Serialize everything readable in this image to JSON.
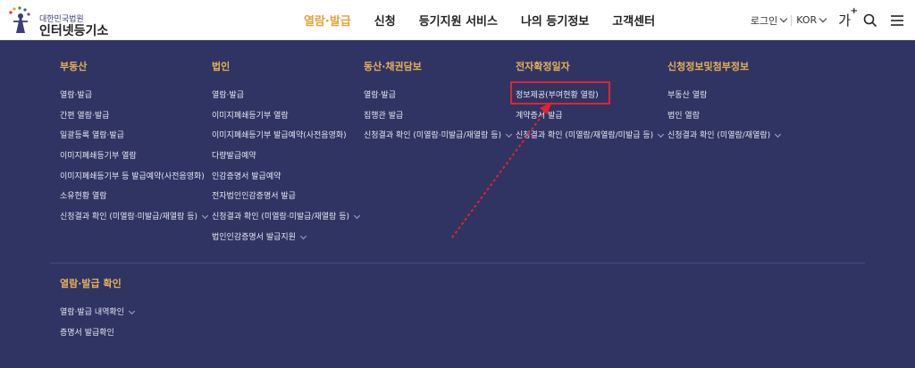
{
  "header": {
    "logo_small": "대한민국법원",
    "logo_big": "인터넷등기소",
    "gnb": [
      {
        "label": "열람·발급",
        "active": true
      },
      {
        "label": "신청",
        "active": false
      },
      {
        "label": "등기지원 서비스",
        "active": false
      },
      {
        "label": "나의 등기정보",
        "active": false
      },
      {
        "label": "고객센터",
        "active": false
      }
    ],
    "util": {
      "login": "로그인",
      "lang": "KOR",
      "font_size": "가",
      "font_plus": "+",
      "search_icon": "search-icon",
      "menu_icon": "hamburger-icon"
    }
  },
  "mega_menu": {
    "columns": [
      {
        "title": "부동산",
        "items": [
          {
            "label": "열람·발급",
            "has_sub": false
          },
          {
            "label": "간편 열람·발급",
            "has_sub": false
          },
          {
            "label": "일괄등록 열람·발급",
            "has_sub": false
          },
          {
            "label": "이미지폐쇄등기부 열람",
            "has_sub": false
          },
          {
            "label": "이미지폐쇄등기부 등 발급예약(사전음영화)",
            "has_sub": false
          },
          {
            "label": "소유현황 열람",
            "has_sub": false
          },
          {
            "label": "신청결과 확인 (미열람·미발급/재열람 등)",
            "has_sub": true
          }
        ]
      },
      {
        "title": "법인",
        "items": [
          {
            "label": "열람·발급",
            "has_sub": false
          },
          {
            "label": "이미지폐쇄등기부 열람",
            "has_sub": false
          },
          {
            "label": "이미지폐쇄등기부 발급예약(사전음영화)",
            "has_sub": false
          },
          {
            "label": "다량발급예약",
            "has_sub": false
          },
          {
            "label": "인감증명서 발급예약",
            "has_sub": false
          },
          {
            "label": "전자법인인감증명서 발급",
            "has_sub": false
          },
          {
            "label": "신청결과 확인 (미열람·미발급/재열람 등)",
            "has_sub": true
          },
          {
            "label": "법인인감증명서 발급지원",
            "has_sub": true
          }
        ]
      },
      {
        "title": "동산·채권담보",
        "items": [
          {
            "label": "열람·발급",
            "has_sub": false
          },
          {
            "label": "집행관 발급",
            "has_sub": false
          },
          {
            "label": "신청결과 확인 (미열람·미발급/재열람 등)",
            "has_sub": true
          }
        ]
      },
      {
        "title": "전자확정일자",
        "items": [
          {
            "label": "정보제공(부여현황 열람)",
            "has_sub": false
          },
          {
            "label": "계약증서 발급",
            "has_sub": false
          },
          {
            "label": "신청결과 확인 (미열람/재열람/미발급 등)",
            "has_sub": true
          }
        ]
      },
      {
        "title": "신청정보및첨부정보",
        "items": [
          {
            "label": "부동산 열람",
            "has_sub": false
          },
          {
            "label": "법인 열람",
            "has_sub": false
          },
          {
            "label": "신청결과 확인 (미열람/재열람)",
            "has_sub": true
          }
        ]
      }
    ],
    "bottom": {
      "title": "열람·발급 확인",
      "items": [
        {
          "label": "열람·발급 내역확인",
          "has_sub": true
        },
        {
          "label": "증명서 발급확인",
          "has_sub": false
        }
      ]
    }
  },
  "colors": {
    "background": "#2f3463",
    "accent": "#e7b05a",
    "highlight": "#e3232d"
  }
}
